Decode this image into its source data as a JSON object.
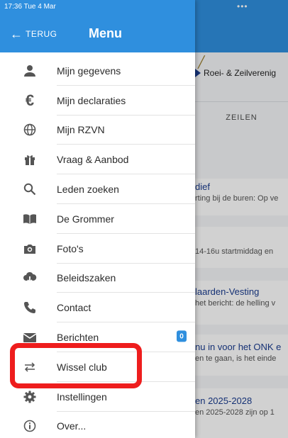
{
  "status_bar": {
    "time": "17:36  Tue 4 Mar",
    "dots": "•••"
  },
  "drawer": {
    "back_label": "TERUG",
    "back_arrow": "←",
    "title": "Menu",
    "items": [
      {
        "label": "Mijn gegevens",
        "icon": "person-icon"
      },
      {
        "label": "Mijn declaraties",
        "icon": "euro-icon"
      },
      {
        "label": "Mijn RZVN",
        "icon": "globe-icon"
      },
      {
        "label": "Vraag & Aanbod",
        "icon": "gift-icon"
      },
      {
        "label": "Leden zoeken",
        "icon": "search-icon"
      },
      {
        "label": "De Grommer",
        "icon": "book-icon"
      },
      {
        "label": "Foto's",
        "icon": "camera-icon"
      },
      {
        "label": "Beleidszaken",
        "icon": "cloud-download-icon"
      },
      {
        "label": "Contact",
        "icon": "phone-icon"
      },
      {
        "label": "Berichten",
        "icon": "mail-icon",
        "badge": "0"
      },
      {
        "label": "Wissel club",
        "icon": "swap-icon"
      },
      {
        "label": "Instellingen",
        "icon": "gear-icon"
      },
      {
        "label": "Over...",
        "icon": "info-icon"
      }
    ]
  },
  "background": {
    "club_name": "Roei- & Zeilverenig",
    "tab": "ZEILEN",
    "cards": [
      {
        "title": "dief",
        "snippet": "rting bij de buren: Op ve"
      },
      {
        "title": "",
        "snippet": "14-16u startmiddag en"
      },
      {
        "title": "laarden-Vesting",
        "snippet": "het bericht: de helling v"
      },
      {
        "title": "nu in voor het ONK e",
        "snippet": "en te gaan, is het einde"
      },
      {
        "title": "en 2025-2028",
        "snippet": "en 2025-2028 zijn op 1"
      }
    ]
  },
  "colors": {
    "header": "#2f8fde",
    "highlight": "#ee1d1d",
    "link": "#1a3c8f"
  }
}
